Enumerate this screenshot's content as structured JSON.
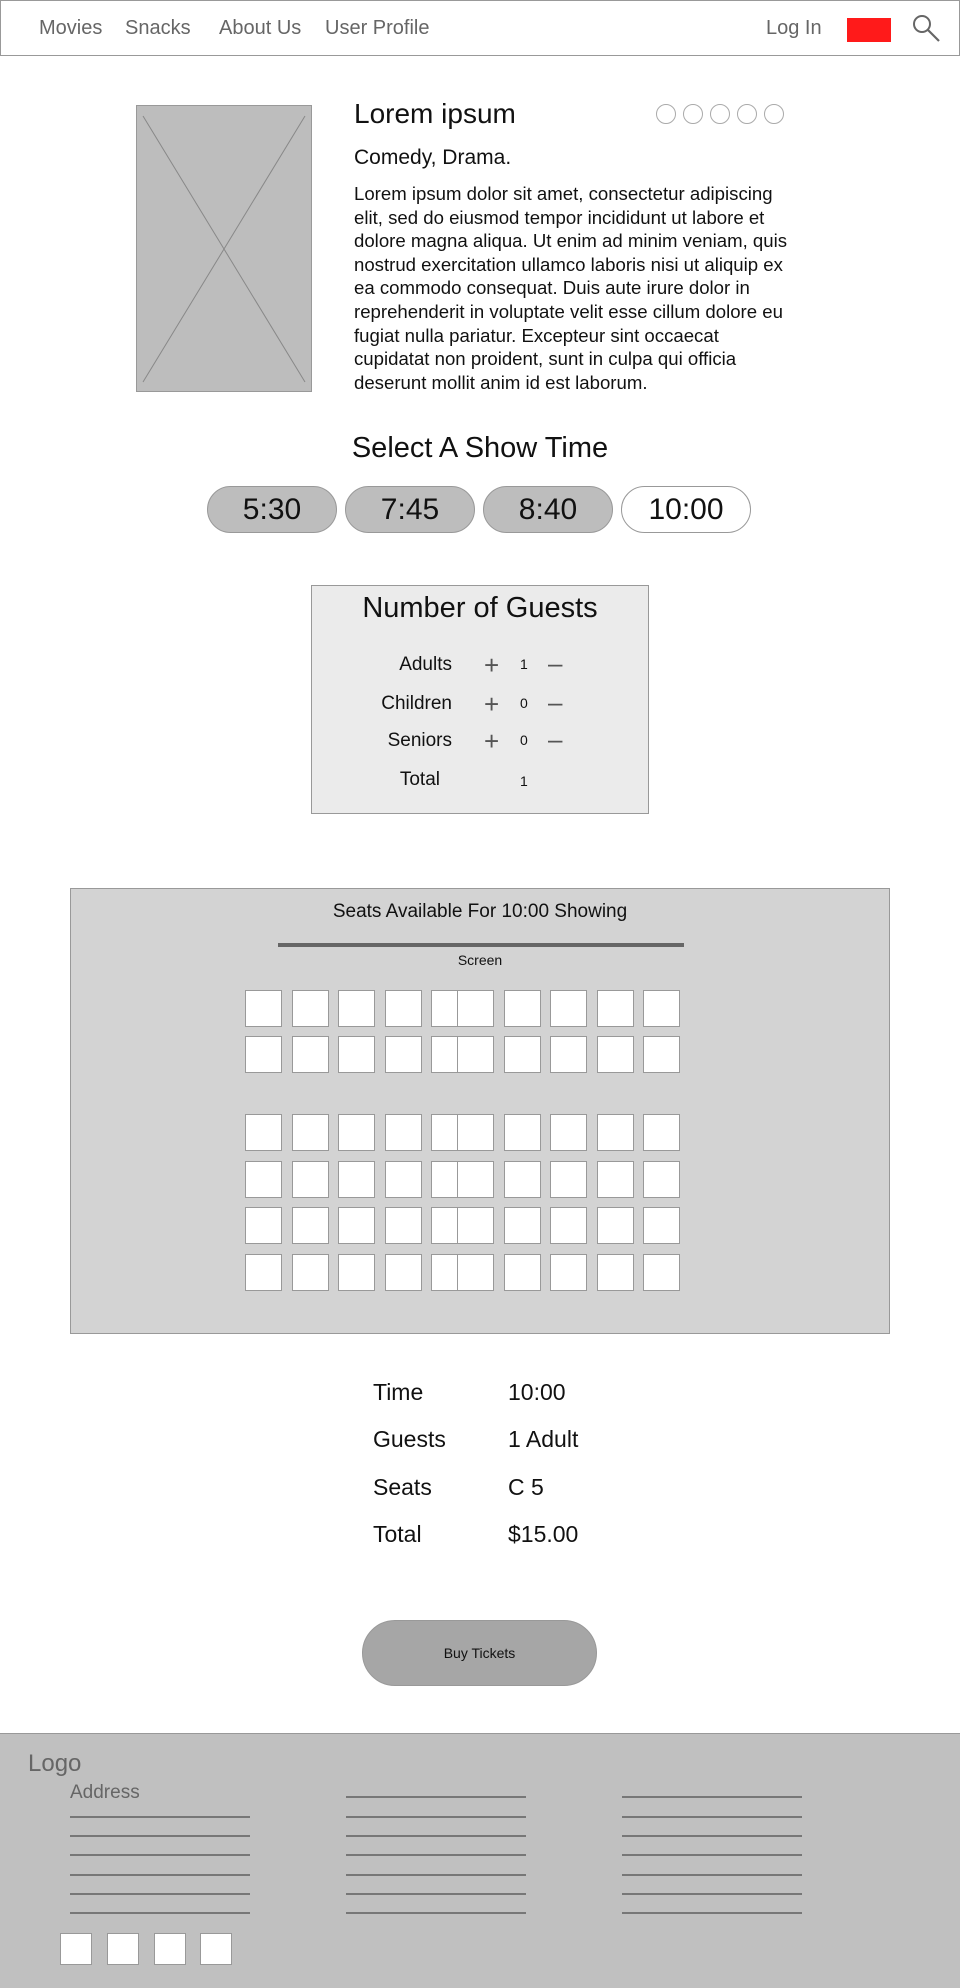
{
  "nav": {
    "movies": "Movies",
    "snacks": "Snacks",
    "about": "About Us",
    "profile": "User Profile",
    "login": "Log In",
    "flag_color": "#ff1a1a"
  },
  "movie": {
    "title": "Lorem ipsum",
    "genres": "Comedy, Drama.",
    "description": "Lorem ipsum dolor sit amet, consectetur adipiscing elit, sed do eiusmod tempor incididunt ut labore et dolore magna aliqua. Ut enim ad minim veniam, quis nostrud exercitation ullamco laboris nisi ut aliquip ex ea commodo consequat. Duis aute irure dolor in reprehenderit in voluptate velit esse cillum dolore eu fugiat nulla pariatur. Excepteur sint occaecat cupidatat non proident, sunt in culpa qui officia deserunt mollit anim id est laborum.",
    "rating_stars": 5,
    "rating_filled": 0
  },
  "showtimes": {
    "title": "Select A Show Time",
    "times": [
      "5:30",
      "7:45",
      "8:40",
      "10:00"
    ],
    "selected": "10:00"
  },
  "guests": {
    "title": "Number of Guests",
    "rows": [
      {
        "label": "Adults",
        "value": "1"
      },
      {
        "label": "Children",
        "value": "0"
      },
      {
        "label": "Seniors",
        "value": "0"
      }
    ],
    "total_label": "Total",
    "total_value": "1"
  },
  "seats": {
    "title": "Seats Available For 10:00 Showing",
    "screen_label": "Screen",
    "rows": 6,
    "cols_per_block": 5,
    "blocks": 2
  },
  "summary": {
    "time_label": "Time",
    "time_value": "10:00",
    "guests_label": "Guests",
    "guests_value": "1 Adult",
    "seats_label": "Seats",
    "seats_value": "C 5",
    "total_label": "Total",
    "total_value": "$15.00"
  },
  "buy_label": "Buy Tickets",
  "footer": {
    "logo": "Logo",
    "address": "Address"
  }
}
